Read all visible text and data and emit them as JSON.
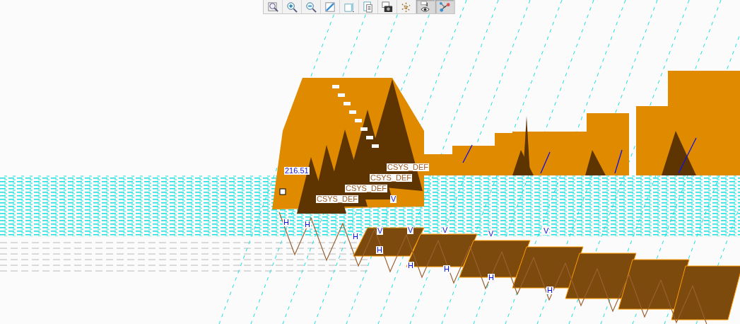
{
  "toolbar": [
    {
      "kind": "zoom-window",
      "pressed": false
    },
    {
      "kind": "zoom-in",
      "pressed": false
    },
    {
      "kind": "zoom-out",
      "pressed": false
    },
    {
      "kind": "repaint",
      "pressed": false
    },
    {
      "kind": "shade",
      "pressed": false
    },
    {
      "kind": "saved-views",
      "pressed": false
    },
    {
      "kind": "camera",
      "pressed": false
    },
    {
      "kind": "datum",
      "pressed": false
    },
    {
      "kind": "display",
      "pressed": true
    },
    {
      "kind": "network",
      "pressed": true
    }
  ],
  "annotations": [
    {
      "kind": "dimension",
      "text": "216.51"
    },
    {
      "kind": "csys",
      "text": "CSYS_DEF"
    },
    {
      "kind": "csys",
      "text": "CSYS_DEF"
    },
    {
      "kind": "csys",
      "text": "CSYS_DEF"
    },
    {
      "kind": "csys",
      "text": "CSYS_DEF"
    },
    {
      "kind": "datum",
      "text": "H"
    },
    {
      "kind": "datum",
      "text": "H"
    },
    {
      "kind": "datum",
      "text": "H"
    },
    {
      "kind": "datum",
      "text": "H"
    },
    {
      "kind": "datum",
      "text": "H"
    },
    {
      "kind": "datum",
      "text": "H"
    },
    {
      "kind": "datum",
      "text": "H"
    },
    {
      "kind": "datum",
      "text": "H"
    },
    {
      "kind": "datum",
      "text": "V"
    },
    {
      "kind": "datum",
      "text": "V"
    },
    {
      "kind": "datum",
      "text": "V"
    },
    {
      "kind": "datum",
      "text": "V"
    },
    {
      "kind": "datum",
      "text": "V"
    },
    {
      "kind": "datum",
      "text": "V"
    }
  ]
}
